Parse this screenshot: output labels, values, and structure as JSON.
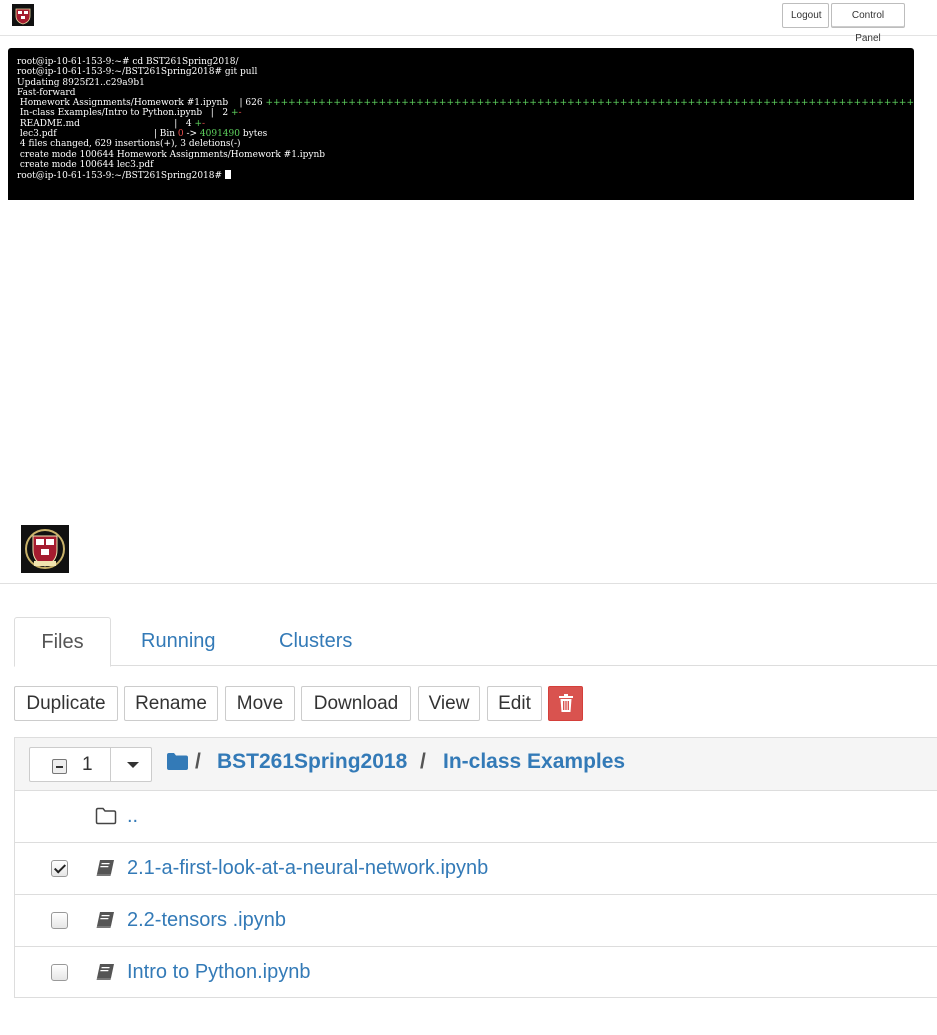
{
  "header": {
    "logout_label": "Logout",
    "control_panel_label": "Control Panel"
  },
  "terminal": {
    "lines": {
      "l1": "root@ip-10-61-153-9:~# cd BST261Spring2018/",
      "l2": "root@ip-10-61-153-9:~/BST261Spring2018# git pull",
      "l3": "Updating 8925f21..c29a9b1",
      "l4": "Fast-forward",
      "l5_file": " Homework Assignments/Homework #1.ipynb    | 626 ",
      "l5_bar": "+++++++++++++++++++++++++++++++++++++++++++++++++++++++++++++++++++++++++++++++++++++++++",
      "l6_file": " In-class Examples/Intro to Python.ipynb   |   2 ",
      "l6_plus": "+",
      "l6_minus": "-",
      "l7_file": " README.md                                 |   4 ",
      "l7_plus": "+",
      "l7_minus": "-",
      "l8_file": " lec3.pdf                                  | Bin ",
      "l8_zero": "0",
      "l8_arrow": " -> ",
      "l8_size": "4091490",
      "l8_bytes": " bytes",
      "l9": " 4 files changed, 629 insertions(+), 3 deletions(-)",
      "l10": " create mode 100644 Homework Assignments/Homework #1.ipynb",
      "l11": " create mode 100644 lec3.pdf",
      "l12": "root@ip-10-61-153-9:~/BST261Spring2018# "
    }
  },
  "tabs": {
    "files": "Files",
    "running": "Running",
    "clusters": "Clusters"
  },
  "toolbar": {
    "duplicate": "Duplicate",
    "rename": "Rename",
    "move": "Move",
    "download": "Download",
    "view": "View",
    "edit": "Edit",
    "delete_icon": "trash-icon"
  },
  "file_list": {
    "selected_count": "1",
    "breadcrumb": {
      "sep": "/",
      "folder1": "BST261Spring2018",
      "folder2": "In-class Examples"
    },
    "rows": [
      {
        "name": "..",
        "icon": "folder-icon",
        "checked": false
      },
      {
        "name": "2.1-a-first-look-at-a-neural-network.ipynb",
        "icon": "notebook-icon",
        "checked": true
      },
      {
        "name": "2.2-tensors .ipynb",
        "icon": "notebook-icon",
        "checked": false
      },
      {
        "name": "Intro to Python.ipynb",
        "icon": "notebook-icon",
        "checked": false
      }
    ]
  },
  "colors": {
    "link": "#337ab7",
    "delete": "#d9534f",
    "terminal_bg": "#000000",
    "diff_add": "#5fd35f",
    "diff_del": "#e84d4d"
  }
}
